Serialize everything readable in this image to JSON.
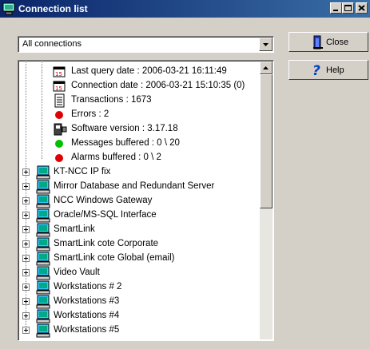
{
  "window": {
    "title": "Connection list"
  },
  "filter": {
    "selected": "All connections"
  },
  "buttons": {
    "close": "Close",
    "help": "Help"
  },
  "details": [
    {
      "label": "Last query date : 2006-03-21 16:11:49",
      "icon": "calendar-icon"
    },
    {
      "label": "Connection date : 2006-03-21 15:10:35  (0)",
      "icon": "calendar-icon"
    },
    {
      "label": "Transactions : 1673",
      "icon": "transactions-icon"
    },
    {
      "label": "Errors : 2",
      "icon": "red-dot-icon"
    },
    {
      "label": "Software version : 3.17.18",
      "icon": "software-icon"
    },
    {
      "label": "Messages buffered : 0 \\ 20",
      "icon": "green-dot-icon"
    },
    {
      "label": "Alarms buffered : 0 \\ 2",
      "icon": "red-dot-icon"
    }
  ],
  "connections": [
    "KT-NCC IP fix",
    "Mirror Database and Redundant Server",
    "NCC Windows Gateway",
    "Oracle/MS-SQL Interface",
    "SmartLink",
    "SmartLink cote Corporate",
    "SmartLink cote Global (email)",
    "Video Vault",
    "Workstations # 2",
    "Workstations #3",
    "Workstations #4",
    "Workstations #5"
  ],
  "colors": {
    "title_start": "#0a246a",
    "title_end": "#3a6ea5",
    "error": "#e00000",
    "ok": "#00c000"
  }
}
